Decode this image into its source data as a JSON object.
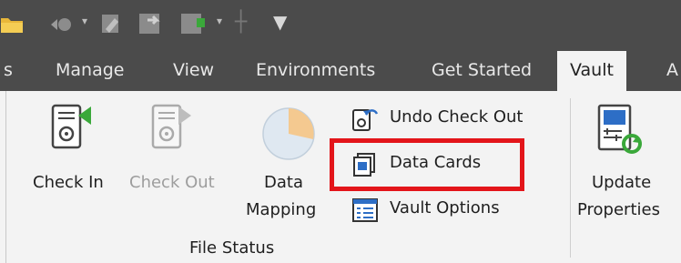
{
  "tabs": [
    "s",
    "Manage",
    "View",
    "Environments",
    "Get Started",
    "Vault",
    "A"
  ],
  "active_tab": "Vault",
  "buttons": {
    "check_in": "Check In",
    "check_out": "Check Out",
    "data_mapping_line1": "Data",
    "data_mapping_line2": "Mapping",
    "undo_check_out": "Undo Check Out",
    "data_cards": "Data Cards",
    "vault_options": "Vault Options",
    "update_properties_line1": "Update",
    "update_properties_line2": "Properties"
  },
  "panel": {
    "title": "File Status"
  },
  "icons": {
    "qat": [
      "folder-icon",
      "back-arrow-icon",
      "dropdown-arrow-icon",
      "tool-icon",
      "import-icon",
      "export-icon",
      "dropdown-arrow-icon",
      "cross-icon",
      "customize-qat-icon"
    ],
    "check_in": "check-in-icon",
    "check_out": "check-out-icon",
    "data_mapping": "pie-chart-icon",
    "undo_check_out": "undo-check-out-icon",
    "data_cards": "data-cards-icon",
    "vault_options": "vault-options-icon",
    "update_properties": "update-properties-icon"
  },
  "colors": {
    "ribbon_bg": "#f3f3f3",
    "tab_bar_bg": "#4b4b4b",
    "highlight": "#e3151a",
    "accent_green": "#3aa83a"
  }
}
